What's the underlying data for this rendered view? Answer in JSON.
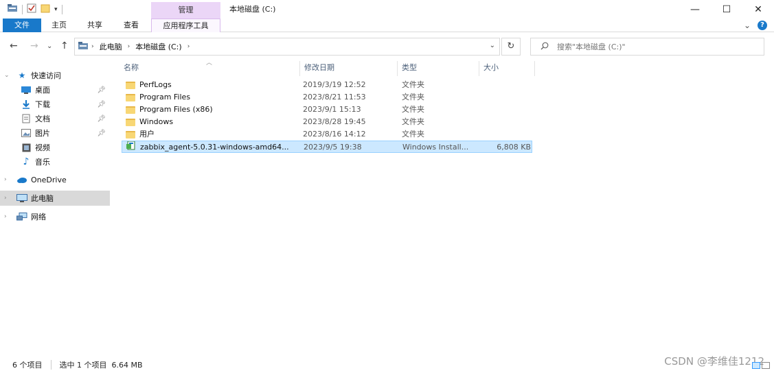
{
  "titlebar": {
    "context_tab": "管理",
    "title": "本地磁盘 (C:)",
    "minimize": "—",
    "maximize": "☐",
    "close": "✕"
  },
  "ribbon": {
    "tabs": [
      "文件",
      "主页",
      "共享",
      "查看",
      "应用程序工具"
    ],
    "help": "?",
    "expand": "⌄"
  },
  "nav": {
    "back": "←",
    "forward": "→",
    "recent": "⌄",
    "up": "↑",
    "breadcrumbs": [
      "此电脑",
      "本地磁盘 (C:)"
    ],
    "refresh": "↻",
    "search_placeholder": "搜索\"本地磁盘 (C:)\""
  },
  "sidebar": {
    "quick_access": "快速访问",
    "quick_items": [
      "桌面",
      "下载",
      "文档",
      "图片",
      "视频",
      "音乐"
    ],
    "onedrive": "OneDrive",
    "this_pc": "此电脑",
    "network": "网络"
  },
  "columns": {
    "name": "名称",
    "date": "修改日期",
    "type": "类型",
    "size": "大小"
  },
  "files": [
    {
      "name": "PerfLogs",
      "date": "2019/3/19 12:52",
      "type": "文件夹",
      "size": ""
    },
    {
      "name": "Program Files",
      "date": "2023/8/21 11:53",
      "type": "文件夹",
      "size": ""
    },
    {
      "name": "Program Files (x86)",
      "date": "2023/9/1 15:13",
      "type": "文件夹",
      "size": ""
    },
    {
      "name": "Windows",
      "date": "2023/8/28 19:45",
      "type": "文件夹",
      "size": ""
    },
    {
      "name": "用户",
      "date": "2023/8/16 14:12",
      "type": "文件夹",
      "size": ""
    },
    {
      "name": "zabbix_agent-5.0.31-windows-amd64...",
      "date": "2023/9/5 19:38",
      "type": "Windows Install...",
      "size": "6,808 KB"
    }
  ],
  "status": {
    "count": "6 个项目",
    "selection": "选中 1 个项目  6.64 MB"
  },
  "watermark": "CSDN @李维佳1212",
  "colors": {
    "accent": "#1979ca",
    "context_tab": "#ebd6f7",
    "selection": "#cce8ff",
    "folder": "#f8d775"
  }
}
